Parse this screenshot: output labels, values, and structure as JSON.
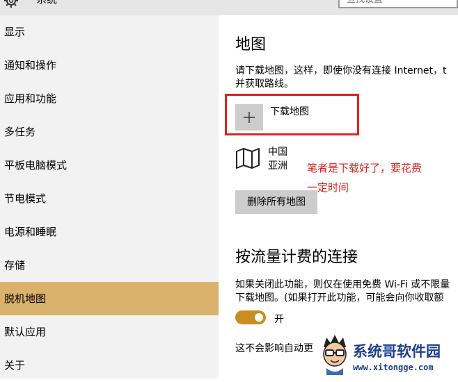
{
  "header": {
    "title": "系统",
    "search_placeholder": "查找设置"
  },
  "sidebar": {
    "items": [
      {
        "label": "显示"
      },
      {
        "label": "通知和操作"
      },
      {
        "label": "应用和功能"
      },
      {
        "label": "多任务"
      },
      {
        "label": "平板电脑模式"
      },
      {
        "label": "节电模式"
      },
      {
        "label": "电源和睡眠"
      },
      {
        "label": "存储"
      },
      {
        "label": "脱机地图",
        "active": true
      },
      {
        "label": "默认应用"
      },
      {
        "label": "关于"
      }
    ]
  },
  "main": {
    "maps_section": {
      "heading": "地图",
      "description_line1": "请下载地图，这样，即使你没有连接 Internet，t",
      "description_line2": "并获取路线。",
      "download_label": "下载地图",
      "map_country": "中国",
      "map_region": "亚洲",
      "delete_all_label": "删除所有地图"
    },
    "metered_section": {
      "heading": "按流量计费的连接",
      "description_line1": "如果关闭此功能，则仅在使用免费 Wi-Fi 或不限量",
      "description_line2": "下载地图。(如果打开此功能，可能会向你收取额",
      "toggle_state": "开",
      "footnote": "这不会影响自动更"
    }
  },
  "annotation": {
    "line1": "笔者是下载好了，要花费",
    "line2": "一定时间",
    "color": "#e02020"
  },
  "watermark": {
    "title": "系统哥软件园",
    "url": "www.xitongge.com"
  },
  "colors": {
    "accent": "#dbb26c",
    "toggle_on": "#c98e1f",
    "highlight_box": "#e02020"
  }
}
